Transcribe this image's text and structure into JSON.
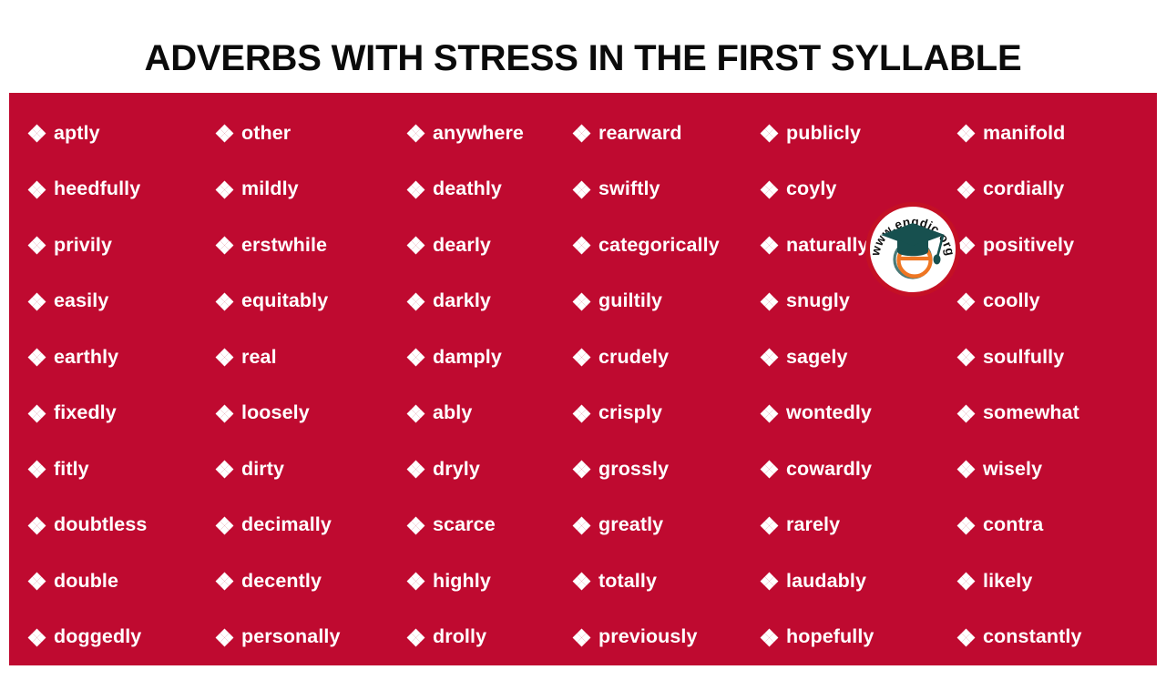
{
  "page": {
    "title": "ADVERBS WITH STRESS IN THE FIRST SYLLABLE",
    "background_color": "#ffffff",
    "panel_color": "#bf0a30",
    "text_color": "#ffffff",
    "title_color": "#0b0b0b",
    "bullet_icon": "four-diamond-bullet-icon"
  },
  "watermark": {
    "text": "www.engdic.org",
    "ring_color": "#c41025",
    "cap_color": "#17504f",
    "letter_color": "#ef7622",
    "letter": "e"
  },
  "columns": [
    {
      "index": 1,
      "words": [
        "aptly",
        "heedfully",
        "privily",
        "easily",
        "earthly",
        "fixedly",
        "fitly",
        "doubtless",
        "double",
        "doggedly"
      ]
    },
    {
      "index": 2,
      "words": [
        "other",
        "mildly",
        "erstwhile",
        "equitably",
        "real",
        "loosely",
        "dirty",
        "decimally",
        "decently",
        "personally"
      ]
    },
    {
      "index": 3,
      "words": [
        "anywhere",
        "deathly",
        "dearly",
        "darkly",
        "damply",
        "ably",
        "dryly",
        "scarce",
        "highly",
        "drolly"
      ]
    },
    {
      "index": 4,
      "words": [
        "rearward",
        "swiftly",
        "categorically",
        "guiltily",
        "crudely",
        "crisply",
        "grossly",
        "greatly",
        "totally",
        "previously"
      ]
    },
    {
      "index": 5,
      "words": [
        "publicly",
        "coyly",
        "naturally",
        "snugly",
        "sagely",
        "wontedly",
        "cowardly",
        "rarely",
        "laudably",
        "hopefully"
      ]
    },
    {
      "index": 6,
      "words": [
        "manifold",
        "cordially",
        "positively",
        "coolly",
        "soulfully",
        "somewhat",
        "wisely",
        "contra",
        "likely",
        "constantly"
      ]
    }
  ]
}
